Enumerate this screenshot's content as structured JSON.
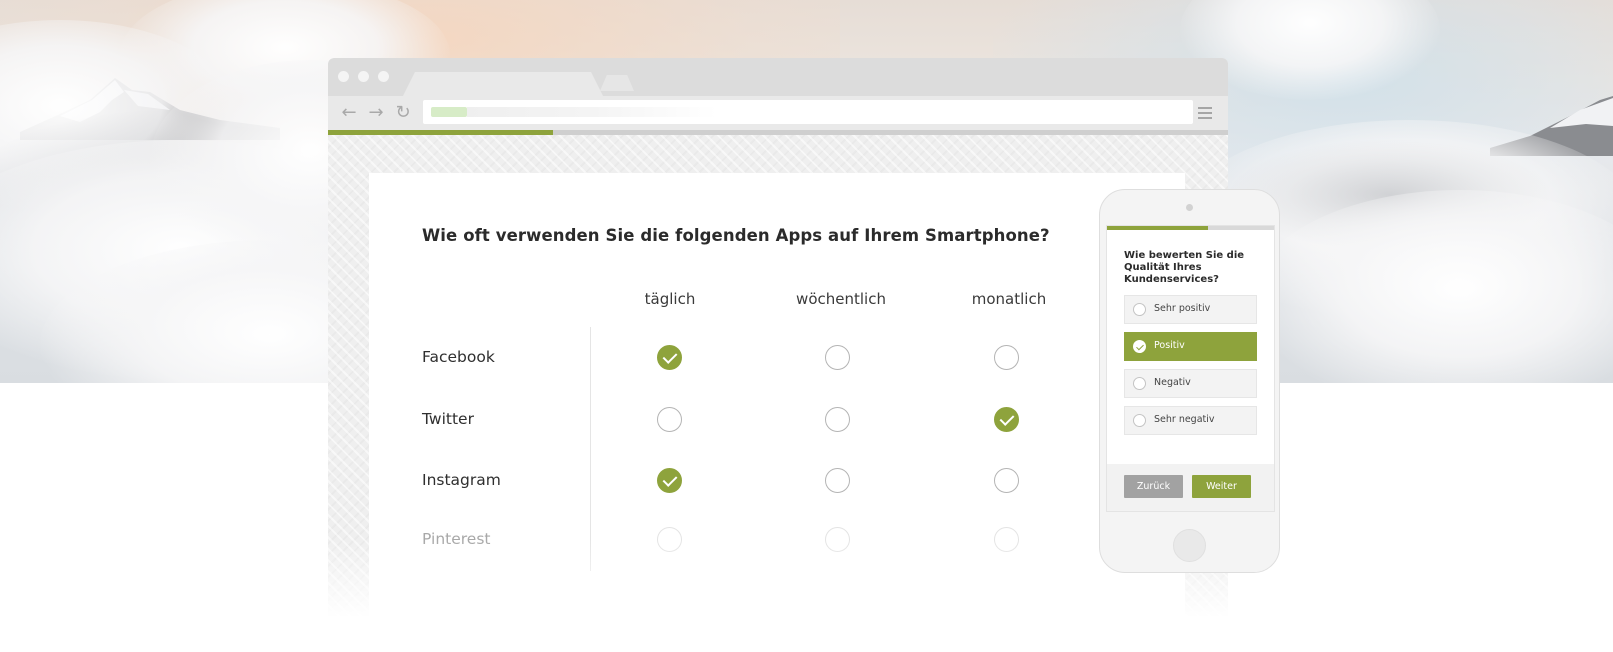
{
  "colors": {
    "accent": "#8ea33c",
    "back_button": "#a2a2a2",
    "text": "#2b2b2b"
  },
  "desktop_survey": {
    "progress_fraction": 0.25,
    "question": "Wie oft verwenden Sie die folgenden Apps auf Ihrem Smartphone?",
    "columns": [
      "täglich",
      "wöchentlich",
      "monatlich"
    ],
    "rows": [
      {
        "label": "Facebook",
        "selected": "täglich"
      },
      {
        "label": "Twitter",
        "selected": "monatlich"
      },
      {
        "label": "Instagram",
        "selected": "täglich"
      },
      {
        "label": "Pinterest",
        "selected": null
      }
    ]
  },
  "mobile_survey": {
    "progress_fraction": 0.6,
    "question": "Wie bewerten Sie die Qualität Ihres Kundenservices?",
    "options": [
      "Sehr positiv",
      "Positiv",
      "Negativ",
      "Sehr negativ"
    ],
    "selected": "Positiv",
    "back_label": "Zurück",
    "next_label": "Weiter"
  },
  "icons": {
    "browser_back": "arrow-left-icon",
    "browser_forward": "arrow-right-icon",
    "browser_reload": "reload-icon",
    "browser_menu": "hamburger-menu-icon",
    "checked": "check-icon"
  }
}
